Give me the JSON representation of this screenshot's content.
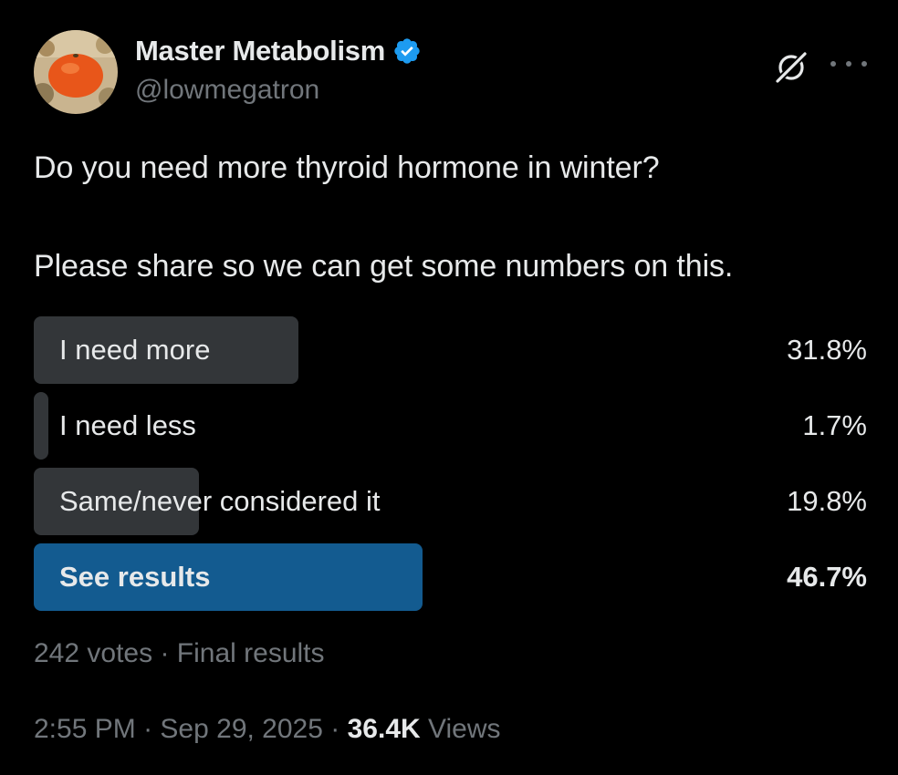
{
  "author": {
    "display_name": "Master Metabolism",
    "handle": "@lowmegatron",
    "verified": true,
    "verified_color": "#1d9bf0",
    "avatar_icon": "orange-fruit-avatar"
  },
  "header_icons": {
    "grok": "grok-icon",
    "more": "more-icon"
  },
  "post": {
    "line1": "Do you need more thyroid hormone in winter?",
    "line2": "Please share so we can get some numbers on this."
  },
  "poll": {
    "options": [
      {
        "label": "I need more",
        "percent_text": "31.8%",
        "percent": 31.8,
        "winner": false
      },
      {
        "label": "I need less",
        "percent_text": "1.7%",
        "percent": 1.7,
        "winner": false
      },
      {
        "label": "Same/never considered it",
        "percent_text": "19.8%",
        "percent": 19.8,
        "winner": false
      },
      {
        "label": "See results",
        "percent_text": "46.7%",
        "percent": 46.7,
        "winner": true
      }
    ],
    "votes": "242 votes",
    "separator": "·",
    "status": "Final results",
    "bar_color": "#333639",
    "winner_color": "#135b90"
  },
  "meta": {
    "time": "2:55 PM",
    "separator": "·",
    "date": "Sep 29, 2025",
    "views_count": "36.4K",
    "views_label": "Views"
  }
}
